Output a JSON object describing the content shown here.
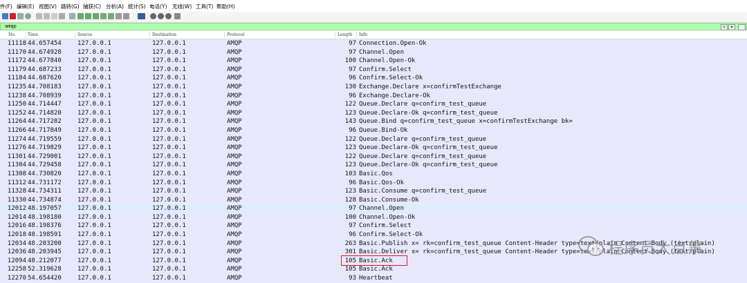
{
  "menu": [
    "件(F)",
    "编辑(E)",
    "视图(V)",
    "跳转(G)",
    "捕获(C)",
    "分析(A)",
    "统计(S)",
    "电话(Y)",
    "无线(W)",
    "工具(T)",
    "帮助(H)"
  ],
  "filter": {
    "value": "amqp",
    "clear_label": "×",
    "dropdown_label": "▾"
  },
  "columns": {
    "no": "No.",
    "time": "Time",
    "source": "Source",
    "destination": "Destination",
    "protocol": "Protocol",
    "length": "Length",
    "info": "Info"
  },
  "packets": [
    {
      "no": "11118",
      "time": "44.657454",
      "src": "127.0.0.1",
      "dst": "127.0.0.1",
      "proto": "AMQP",
      "len": "97",
      "info": "Connection.Open-Ok"
    },
    {
      "no": "11170",
      "time": "44.674928",
      "src": "127.0.0.1",
      "dst": "127.0.0.1",
      "proto": "AMQP",
      "len": "97",
      "info": "Channel.Open"
    },
    {
      "no": "11172",
      "time": "44.677840",
      "src": "127.0.0.1",
      "dst": "127.0.0.1",
      "proto": "AMQP",
      "len": "100",
      "info": "Channel.Open-Ok"
    },
    {
      "no": "11179",
      "time": "44.687233",
      "src": "127.0.0.1",
      "dst": "127.0.0.1",
      "proto": "AMQP",
      "len": "97",
      "info": "Confirm.Select"
    },
    {
      "no": "11184",
      "time": "44.687620",
      "src": "127.0.0.1",
      "dst": "127.0.0.1",
      "proto": "AMQP",
      "len": "96",
      "info": "Confirm.Select-Ok"
    },
    {
      "no": "11235",
      "time": "44.708183",
      "src": "127.0.0.1",
      "dst": "127.0.0.1",
      "proto": "AMQP",
      "len": "130",
      "info": "Exchange.Declare x=confirmTestExchange"
    },
    {
      "no": "11238",
      "time": "44.708939",
      "src": "127.0.0.1",
      "dst": "127.0.0.1",
      "proto": "AMQP",
      "len": "96",
      "info": "Exchange.Declare-Ok"
    },
    {
      "no": "11250",
      "time": "44.714447",
      "src": "127.0.0.1",
      "dst": "127.0.0.1",
      "proto": "AMQP",
      "len": "122",
      "info": "Queue.Declare q=confirm_test_queue"
    },
    {
      "no": "11252",
      "time": "44.714820",
      "src": "127.0.0.1",
      "dst": "127.0.0.1",
      "proto": "AMQP",
      "len": "123",
      "info": "Queue.Declare-Ok q=confirm_test_queue"
    },
    {
      "no": "11264",
      "time": "44.717282",
      "src": "127.0.0.1",
      "dst": "127.0.0.1",
      "proto": "AMQP",
      "len": "143",
      "info": "Queue.Bind q=confirm_test_queue x=confirmTestExchange bk="
    },
    {
      "no": "11266",
      "time": "44.717849",
      "src": "127.0.0.1",
      "dst": "127.0.0.1",
      "proto": "AMQP",
      "len": "96",
      "info": "Queue.Bind-Ok"
    },
    {
      "no": "11274",
      "time": "44.719559",
      "src": "127.0.0.1",
      "dst": "127.0.0.1",
      "proto": "AMQP",
      "len": "122",
      "info": "Queue.Declare q=confirm_test_queue"
    },
    {
      "no": "11276",
      "time": "44.719829",
      "src": "127.0.0.1",
      "dst": "127.0.0.1",
      "proto": "AMQP",
      "len": "123",
      "info": "Queue.Declare-Ok q=confirm_test_queue"
    },
    {
      "no": "11301",
      "time": "44.729001",
      "src": "127.0.0.1",
      "dst": "127.0.0.1",
      "proto": "AMQP",
      "len": "122",
      "info": "Queue.Declare q=confirm_test_queue"
    },
    {
      "no": "11304",
      "time": "44.729458",
      "src": "127.0.0.1",
      "dst": "127.0.0.1",
      "proto": "AMQP",
      "len": "123",
      "info": "Queue.Declare-Ok q=confirm_test_queue"
    },
    {
      "no": "11308",
      "time": "44.730820",
      "src": "127.0.0.1",
      "dst": "127.0.0.1",
      "proto": "AMQP",
      "len": "103",
      "info": "Basic.Qos"
    },
    {
      "no": "11312",
      "time": "44.731172",
      "src": "127.0.0.1",
      "dst": "127.0.0.1",
      "proto": "AMQP",
      "len": "96",
      "info": "Basic.Qos-Ok"
    },
    {
      "no": "11328",
      "time": "44.734311",
      "src": "127.0.0.1",
      "dst": "127.0.0.1",
      "proto": "AMQP",
      "len": "123",
      "info": "Basic.Consume q=confirm_test_queue"
    },
    {
      "no": "11330",
      "time": "44.734874",
      "src": "127.0.0.1",
      "dst": "127.0.0.1",
      "proto": "AMQP",
      "len": "128",
      "info": "Basic.Consume-Ok"
    },
    {
      "no": "12012",
      "time": "48.197057",
      "src": "127.0.0.1",
      "dst": "127.0.0.1",
      "proto": "AMQP",
      "len": "97",
      "info": "Channel.Open",
      "selected": true
    },
    {
      "no": "12014",
      "time": "48.198180",
      "src": "127.0.0.1",
      "dst": "127.0.0.1",
      "proto": "AMQP",
      "len": "100",
      "info": "Channel.Open-Ok"
    },
    {
      "no": "12016",
      "time": "48.198376",
      "src": "127.0.0.1",
      "dst": "127.0.0.1",
      "proto": "AMQP",
      "len": "97",
      "info": "Confirm.Select"
    },
    {
      "no": "12018",
      "time": "48.198591",
      "src": "127.0.0.1",
      "dst": "127.0.0.1",
      "proto": "AMQP",
      "len": "96",
      "info": "Confirm.Select-Ok"
    },
    {
      "no": "12034",
      "time": "48.203200",
      "src": "127.0.0.1",
      "dst": "127.0.0.1",
      "proto": "AMQP",
      "len": "263",
      "info": "Basic.Publish x= rk=confirm_test_queue Content-Header type=text/plain Content-Body (text/plain)"
    },
    {
      "no": "12036",
      "time": "48.203945",
      "src": "127.0.0.1",
      "dst": "127.0.0.1",
      "proto": "AMQP",
      "len": "301",
      "info": "Basic.Deliver x= rk=confirm_test_queue Content-Header type=text/plain Content-Body (text/plain)"
    },
    {
      "no": "12094",
      "time": "48.212077",
      "src": "127.0.0.1",
      "dst": "127.0.0.1",
      "proto": "AMQP",
      "len": "105",
      "info": "Basic.Ack"
    },
    {
      "no": "12258",
      "time": "52.319628",
      "src": "127.0.0.1",
      "dst": "127.0.0.1",
      "proto": "AMQP",
      "len": "105",
      "info": "Basic.Ack"
    },
    {
      "no": "12270",
      "time": "54.654420",
      "src": "127.0.0.1",
      "dst": "127.0.0.1",
      "proto": "AMQP",
      "len": "93",
      "info": "Heartbeat"
    }
  ],
  "watermark": {
    "text": "程序员大点事",
    "icon": "wechat-icon"
  },
  "colors": {
    "row_bg": "#e8e8fc",
    "filter_bg": "#afffaf",
    "highlight_border": "#e0141e"
  }
}
